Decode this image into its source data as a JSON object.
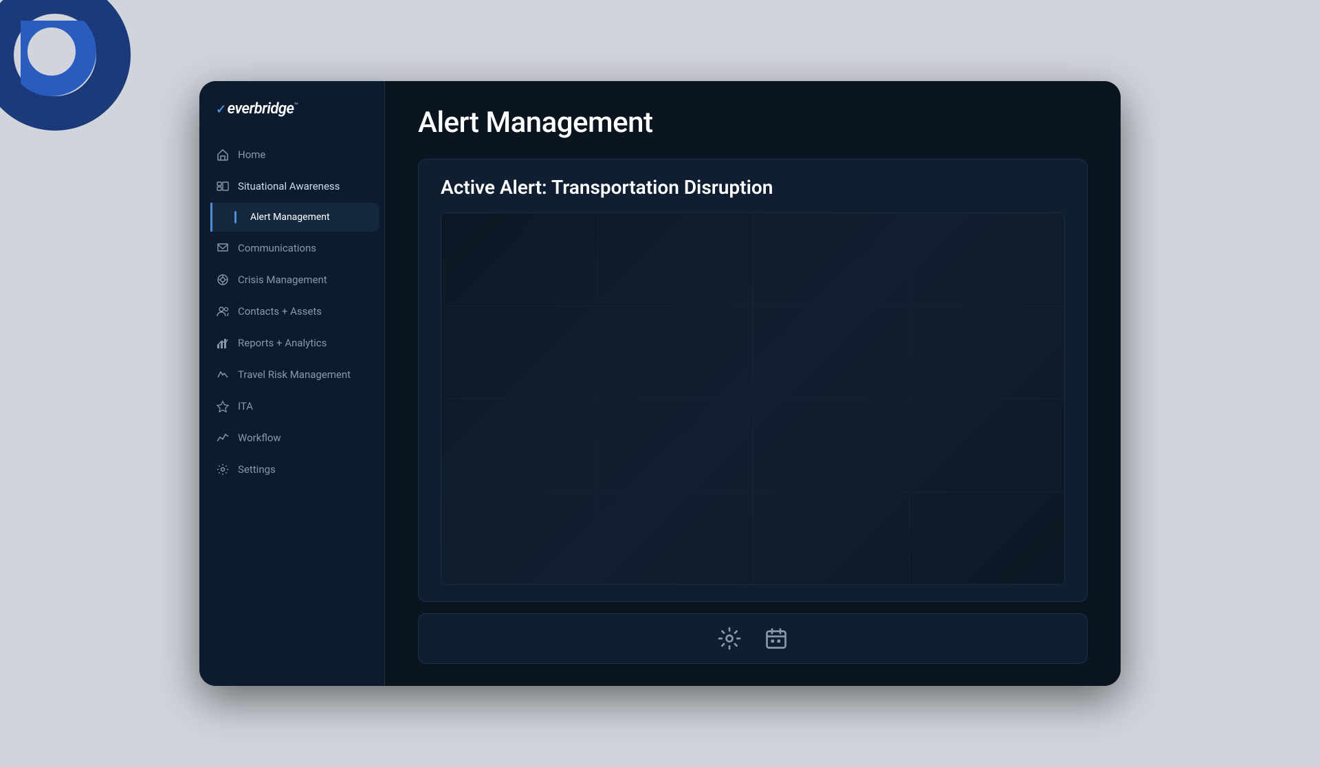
{
  "app": {
    "logo": "everbridge",
    "logo_tm": "™"
  },
  "sidebar": {
    "items": [
      {
        "id": "home",
        "label": "Home",
        "icon": "home-icon",
        "active": false,
        "sub": []
      },
      {
        "id": "situational-awareness",
        "label": "Situational Awareness",
        "icon": "awareness-icon",
        "active": true,
        "sub": [
          {
            "id": "alert-management",
            "label": "Alert Management",
            "active": true
          }
        ]
      },
      {
        "id": "communications",
        "label": "Communications",
        "icon": "comm-icon",
        "active": false,
        "sub": []
      },
      {
        "id": "crisis-management",
        "label": "Crisis Management",
        "icon": "crisis-icon",
        "active": false,
        "sub": []
      },
      {
        "id": "contacts-assets",
        "label": "Contacts + Assets",
        "icon": "contacts-icon",
        "active": false,
        "sub": []
      },
      {
        "id": "reports-analytics",
        "label": "Reports + Analytics",
        "icon": "reports-icon",
        "active": false,
        "sub": []
      },
      {
        "id": "travel-risk",
        "label": "Travel Risk Management",
        "icon": "travel-icon",
        "active": false,
        "sub": []
      },
      {
        "id": "ita",
        "label": "ITA",
        "icon": "ita-icon",
        "active": false,
        "sub": []
      },
      {
        "id": "workflow",
        "label": "Workflow",
        "icon": "workflow-icon",
        "active": false,
        "sub": []
      },
      {
        "id": "settings",
        "label": "Settings",
        "icon": "settings-icon",
        "active": false,
        "sub": []
      }
    ]
  },
  "main": {
    "page_title": "Alert Management",
    "alert": {
      "label": "Active Alert: ",
      "name": "Transportation Disruption"
    },
    "toolbar": {
      "icons": [
        "gear-icon",
        "calendar-icon"
      ]
    }
  }
}
